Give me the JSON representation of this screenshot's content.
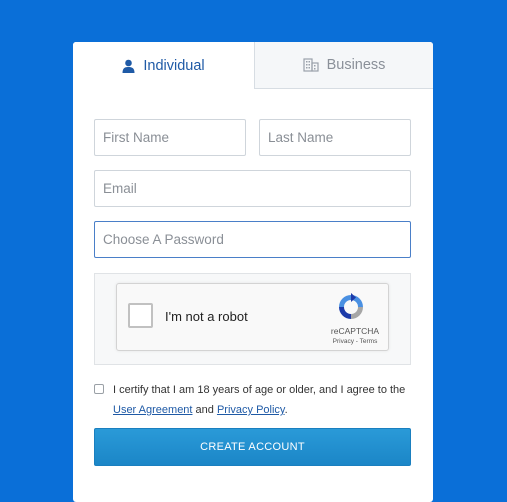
{
  "colors": {
    "background": "#0a6fd8",
    "accent": "#1f5aa6",
    "button": "#1b86c7"
  },
  "tabs": [
    {
      "label": "Individual",
      "icon": "user-icon",
      "active": true
    },
    {
      "label": "Business",
      "icon": "building-icon",
      "active": false
    }
  ],
  "form": {
    "first_name_placeholder": "First Name",
    "last_name_placeholder": "Last Name",
    "email_placeholder": "Email",
    "password_placeholder": "Choose A Password"
  },
  "captcha": {
    "label": "I'm not a robot",
    "brand": "reCAPTCHA",
    "privacy": "Privacy",
    "separator": " - ",
    "terms": "Terms"
  },
  "certify": {
    "text_before": "I certify that I am 18 years of age or older, and I agree to the",
    "user_agreement": "User Agreement",
    "and": " and ",
    "privacy_policy": "Privacy Policy",
    "period": "."
  },
  "submit_label": "CREATE ACCOUNT"
}
